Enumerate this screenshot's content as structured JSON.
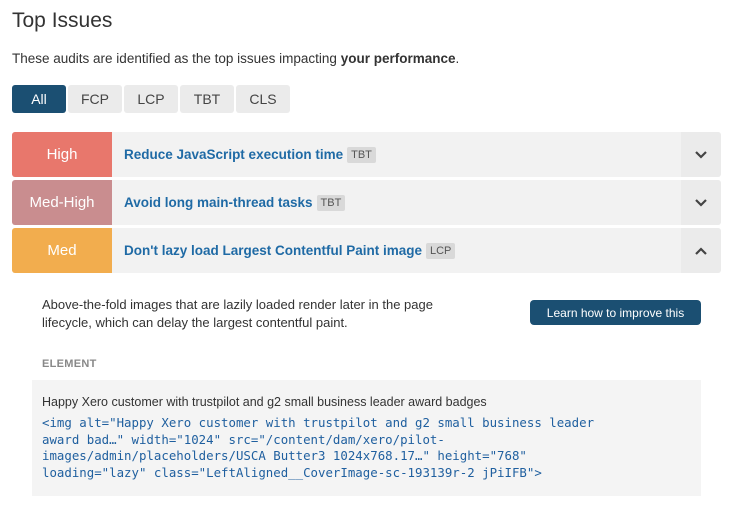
{
  "page": {
    "title": "Top Issues",
    "subtitle_prefix": "These audits are identified as the top issues impacting ",
    "subtitle_bold": "your performance",
    "subtitle_suffix": "."
  },
  "tabs": [
    {
      "label": "All",
      "active": true
    },
    {
      "label": "FCP",
      "active": false
    },
    {
      "label": "LCP",
      "active": false
    },
    {
      "label": "TBT",
      "active": false
    },
    {
      "label": "CLS",
      "active": false
    }
  ],
  "issues": [
    {
      "severity": "High",
      "severity_color": "#e8776c",
      "title": "Reduce JavaScript execution time",
      "badge": "TBT",
      "chevron": "chevron-down-icon"
    },
    {
      "severity": "Med-High",
      "severity_color": "#c98d8f",
      "title": "Avoid long main-thread tasks",
      "badge": "TBT",
      "chevron": "chevron-down-icon"
    },
    {
      "severity": "Med",
      "severity_color": "#f2ad4e",
      "title": "Don't lazy load Largest Contentful Paint image",
      "badge": "LCP",
      "chevron": "chevron-up-icon"
    }
  ],
  "details": {
    "description_line1": "Above-the-fold images that are lazily loaded render later in the page",
    "description_line2": "lifecycle, which can delay the largest contentful paint.",
    "learn_button": "Learn how to improve this",
    "element_label": "ELEMENT",
    "element_caption": "Happy Xero customer with trustpilot and g2 small business leader award badges",
    "code_lines": [
      "<img alt=\"Happy Xero customer with trustpilot and g2 small business leader",
      "award bad…\" width=\"1024\" src=\"/content/dam/xero/pilot-",
      "images/admin/placeholders/USCA Butter3 1024x768.17…\" height=\"768\"",
      "loading=\"lazy\" class=\"LeftAligned__CoverImage-sc-193139r-2 jPiIFB\">"
    ]
  },
  "colors": {
    "accent": "#1b4f72",
    "link": "#1f6aa5"
  }
}
